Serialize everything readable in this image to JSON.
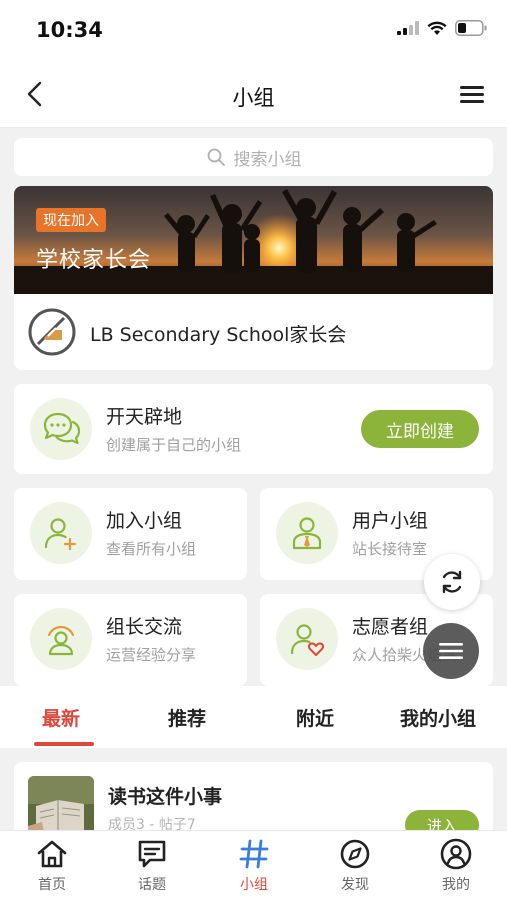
{
  "status_bar": {
    "time": "10:34"
  },
  "nav": {
    "title": "小组"
  },
  "search": {
    "placeholder": "搜索小组"
  },
  "banner": {
    "badge": "现在加入",
    "title": "学校家长会"
  },
  "school": {
    "name": "LB Secondary School家长会"
  },
  "create_card": {
    "title": "开天辟地",
    "subtitle": "创建属于自己的小组",
    "button": "立即创建"
  },
  "grid": [
    {
      "title": "加入小组",
      "subtitle": "查看所有小组",
      "icon": "user-add-icon"
    },
    {
      "title": "用户小组",
      "subtitle": "站长接待室",
      "icon": "user-tie-icon"
    },
    {
      "title": "组长交流",
      "subtitle": "运营经验分享",
      "icon": "user-signal-icon"
    },
    {
      "title": "志愿者组",
      "subtitle": "众人拾柴火焰高",
      "icon": "user-heart-icon"
    }
  ],
  "tabs": [
    "最新",
    "推荐",
    "附近",
    "我的小组"
  ],
  "active_tab": "最新",
  "group": {
    "title": "读书这件小事",
    "meta": "成员3 - 帖子7",
    "button": "进入"
  },
  "bottom_nav": [
    {
      "label": "首页",
      "icon": "home-icon"
    },
    {
      "label": "话题",
      "icon": "chat-icon"
    },
    {
      "label": "小组",
      "icon": "hashtag-icon"
    },
    {
      "label": "发现",
      "icon": "compass-icon"
    },
    {
      "label": "我的",
      "icon": "profile-icon"
    }
  ],
  "active_bottom": "小组",
  "colors": {
    "accent_green": "#8cb43a",
    "accent_red": "#e0473a",
    "badge_orange": "#e8742a",
    "icon_bg": "#eef4e4",
    "icon_green": "#8cb43a"
  }
}
